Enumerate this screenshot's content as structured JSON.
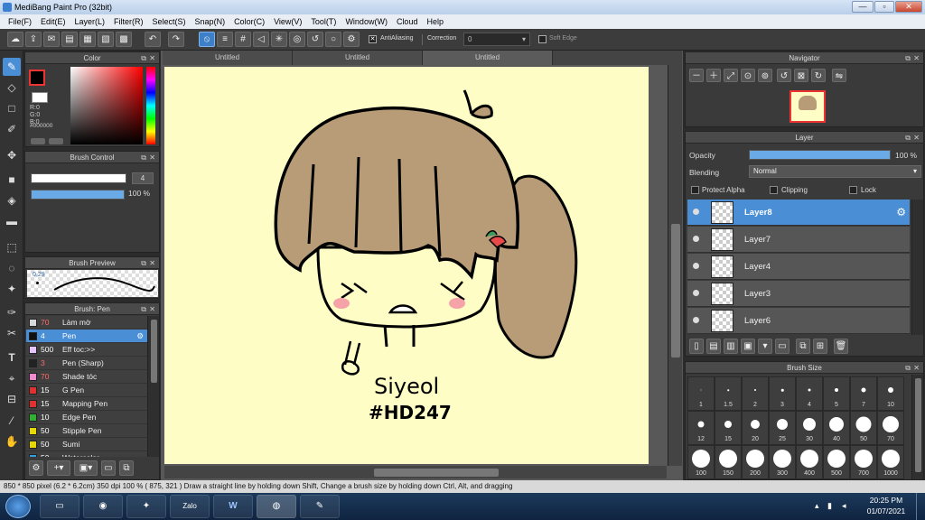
{
  "window": {
    "title": "MediBang Paint Pro (32bit)",
    "minimize": "—",
    "restore": "▫",
    "close": "✕"
  },
  "menu": [
    "File(F)",
    "Edit(E)",
    "Layer(L)",
    "Filter(R)",
    "Select(S)",
    "Snap(N)",
    "Color(C)",
    "View(V)",
    "Tool(T)",
    "Window(W)",
    "Cloud",
    "Help"
  ],
  "toolbar": {
    "antialiasing_label": "AntiAliasing",
    "antialiasing_checked": true,
    "correction_label": "Correction",
    "correction_value": "0",
    "soft_edge_label": "Soft Edge",
    "soft_edge_checked": false
  },
  "color_panel": {
    "title": "Color",
    "fg_color": "#000000",
    "r_label": "R:0",
    "g_label": "G:0",
    "b_label": "B:0",
    "hex": "#000000"
  },
  "brush_control": {
    "title": "Brush Control",
    "size_value": "4",
    "opacity_value": "100 %",
    "opacity_fraction": 1.0
  },
  "brush_preview": {
    "title": "Brush Preview",
    "size_label": "0.29"
  },
  "brush_list": {
    "title": "Brush: Pen",
    "items": [
      {
        "size": "70",
        "name": "Làm mờ",
        "color": "#d8d8d8",
        "size_color": "#ff6b6b",
        "selected": false
      },
      {
        "size": "4",
        "name": "Pen",
        "color": "#111111",
        "size_color": "#ffffff",
        "selected": true
      },
      {
        "size": "500",
        "name": "Eff toc:>>",
        "color": "#e6c6ff",
        "size_color": "#ffffff",
        "selected": false
      },
      {
        "size": "3",
        "name": "Pen (Sharp)",
        "color": "#222222",
        "size_color": "#ff6b6b",
        "selected": false
      },
      {
        "size": "70",
        "name": "Shade tóc",
        "color": "#f28ad0",
        "size_color": "#ff6b6b",
        "selected": false
      },
      {
        "size": "15",
        "name": "G Pen",
        "color": "#e03030",
        "size_color": "#ffffff",
        "selected": false
      },
      {
        "size": "15",
        "name": "Mapping Pen",
        "color": "#e03030",
        "size_color": "#ffffff",
        "selected": false
      },
      {
        "size": "10",
        "name": "Edge Pen",
        "color": "#30b030",
        "size_color": "#ffffff",
        "selected": false
      },
      {
        "size": "50",
        "name": "Stipple Pen",
        "color": "#e6d800",
        "size_color": "#ffffff",
        "selected": false
      },
      {
        "size": "50",
        "name": "Sumi",
        "color": "#e6d800",
        "size_color": "#ffffff",
        "selected": false
      },
      {
        "size": "50",
        "name": "Watercolor",
        "color": "#30a0e0",
        "size_color": "#ffffff",
        "selected": false
      }
    ]
  },
  "tabs": [
    {
      "label": "Untitled",
      "active": false
    },
    {
      "label": "Untitled",
      "active": false
    },
    {
      "label": "Untitled",
      "active": true
    }
  ],
  "artwork": {
    "signature": "Siyeol",
    "tag": "#HD247",
    "bg_color": "#fffdc6",
    "hair_color": "#b89c78"
  },
  "navigator": {
    "title": "Navigator"
  },
  "layer_panel": {
    "title": "Layer",
    "opacity_label": "Opacity",
    "opacity_value": "100 %",
    "opacity_fraction": 1.0,
    "blending_label": "Blending",
    "blending_value": "Normal",
    "protect_alpha_label": "Protect Alpha",
    "clipping_label": "Clipping",
    "lock_label": "Lock",
    "layers": [
      {
        "name": "Layer8",
        "selected": true
      },
      {
        "name": "Layer7",
        "selected": false
      },
      {
        "name": "Layer4",
        "selected": false
      },
      {
        "name": "Layer3",
        "selected": false
      },
      {
        "name": "Layer6",
        "selected": false
      }
    ]
  },
  "brush_size": {
    "title": "Brush Size",
    "sizes": [
      "1",
      "1.5",
      "2",
      "3",
      "4",
      "5",
      "7",
      "10",
      "12",
      "15",
      "20",
      "25",
      "30",
      "40",
      "50",
      "70",
      "100",
      "150",
      "200",
      "300",
      "400",
      "500",
      "700",
      "1000"
    ]
  },
  "status": {
    "text": "850 * 850 pixel   (6.2 * 6.2cm)   350 dpi   100 %   ( 875, 321 )   Draw a straight line by holding down Shift, Change a brush size by holding down Ctrl, Alt, and dragging"
  },
  "taskbar": {
    "time": "20:25 PM",
    "date": "01/07/2021",
    "zalo_label": "Zalo",
    "word_label": "W"
  }
}
